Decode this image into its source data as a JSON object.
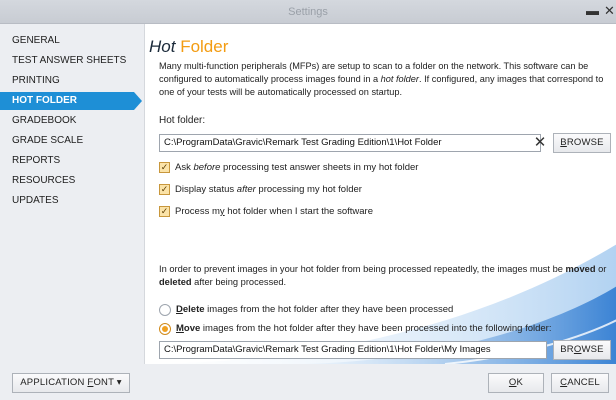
{
  "window": {
    "title": "Settings",
    "minimize_glyph": "▬",
    "close_glyph": "✕"
  },
  "sidebar": {
    "items": [
      {
        "label": "GENERAL"
      },
      {
        "label": "TEST ANSWER SHEETS"
      },
      {
        "label": "PRINTING"
      },
      {
        "label": "HOT FOLDER",
        "active": true
      },
      {
        "label": "GRADEBOOK"
      },
      {
        "label": "GRADE SCALE"
      },
      {
        "label": "REPORTS"
      },
      {
        "label": "RESOURCES"
      },
      {
        "label": "UPDATES"
      }
    ]
  },
  "panel": {
    "title_main": "Hot ",
    "title_accent": "Folder",
    "desc_a": "Many multi-function peripherals (MFPs) are setup to scan to a folder on the network. This software can be configured to automatically process images found in a ",
    "desc_em": "hot folder",
    "desc_b": ". If configured, any images that correspond to one of your tests will be automatically processed on startup.",
    "hot_folder_label": "Hot folder:",
    "hot_folder_value": "C:\\ProgramData\\Gravic\\Remark Test Grading Edition\\1\\Hot Folder",
    "clear_glyph": "✕",
    "browse_rest": "ROWSE",
    "browse_key": "B",
    "checkboxes": [
      {
        "pre": "Ask ",
        "em": "before",
        "post": " processing test answer sheets in my hot folder",
        "checked": true
      },
      {
        "pre": "Display status ",
        "em": "after",
        "post": " processing my hot folder",
        "checked": true
      },
      {
        "pre": "Process m",
        "u": "y",
        "post": " hot folder when I start the software",
        "checked": true
      }
    ],
    "check_glyph": "✓",
    "note_a": "In order to prevent images in your hot folder from being processed repeatedly, the images must be ",
    "note_moved": "moved",
    "note_b": " or ",
    "note_deleted": "deleted",
    "note_c": " after being processed.",
    "radio_delete_key": "D",
    "radio_delete_bold": "elete",
    "radio_delete_rest": " images from the hot folder after they have been processed",
    "radio_move_key": "M",
    "radio_move_bold": "ove",
    "radio_move_rest": " images from the hot folder after they have been processed into the following folder:",
    "move_folder_value": "C:\\ProgramData\\Gravic\\Remark Test Grading Edition\\1\\Hot Folder\\My Images",
    "browse2_pre": "BR",
    "browse2_key": "O",
    "browse2_post": "WSE"
  },
  "footer": {
    "font_pre": "APPLICATION ",
    "font_key": "F",
    "font_post": "ONT",
    "font_caret": "▾",
    "ok_key": "O",
    "ok_post": "K",
    "cancel_key": "C",
    "cancel_post": "ANCEL"
  },
  "colors": {
    "accent_blue": "#1e8fd6",
    "accent_orange": "#f39c12",
    "checkbox_fill": "#fbe3a8"
  }
}
